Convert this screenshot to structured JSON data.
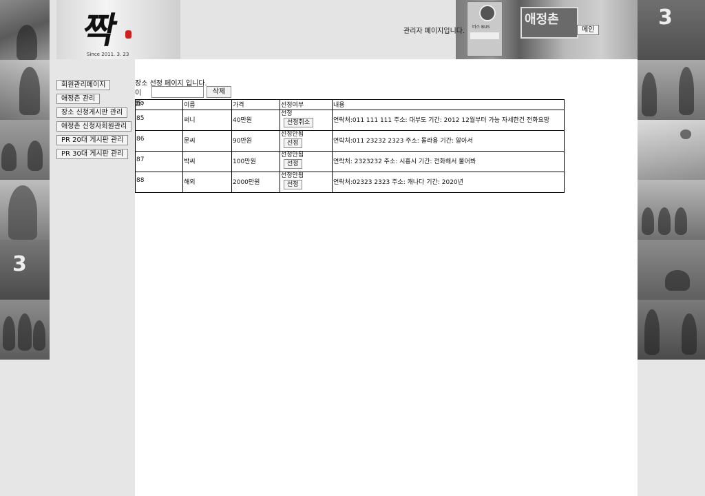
{
  "header": {
    "logo_glyph": "짝",
    "logo_since": "Since 2011. 3. 23",
    "admin_label": "관리자 페이지입니다.",
    "main_button": "메인",
    "village_sign": "애정촌",
    "bus_sign": "버스 BUS"
  },
  "sidebar": {
    "items": [
      {
        "label": "회원관리페이지"
      },
      {
        "label": "애정촌 관리"
      },
      {
        "label": "장소 신청게시판 관리"
      },
      {
        "label": "애정촌 신청자회원관리"
      },
      {
        "label": "PR 20대 게시판 관리"
      },
      {
        "label": "PR 30대 게시판 관리"
      }
    ]
  },
  "main": {
    "title": "장소 선정 페이지 입니다.",
    "search": {
      "label": "이름:",
      "value": "",
      "placeholder": ""
    },
    "delete_button": "삭제",
    "table": {
      "headers": {
        "no": "no",
        "name": "이름",
        "price": "가격",
        "selection": "선정여부",
        "detail": "내용"
      },
      "rows": [
        {
          "no": "85",
          "name": "써니",
          "price": "40만원",
          "status": "선정",
          "button": "선정취소",
          "detail": "연락처:011 111 111 주소: 대부도 기간: 2012 12월부터 가능 자세한건 전화요망"
        },
        {
          "no": "86",
          "name": "문씨",
          "price": "90만원",
          "status": "선정안됨",
          "button": "선정",
          "detail": "연락처:011 23232 2323 주소: 몰라용 기간: 알아서"
        },
        {
          "no": "87",
          "name": "박씨",
          "price": "100만원",
          "status": "선정안됨",
          "button": "선정",
          "detail": "연락처: 2323232 주소: 시흥시 기간: 전화해서 물어봐"
        },
        {
          "no": "88",
          "name": "해외",
          "price": "2000만원",
          "status": "선정안됨",
          "button": "선정",
          "detail": "연락처:02323 2323 주소: 캐나다 기간: 2020년"
        }
      ]
    }
  },
  "colors": {
    "page_bg": "#e6e6e6",
    "content_bg": "#ffffff",
    "border": "#000000"
  }
}
